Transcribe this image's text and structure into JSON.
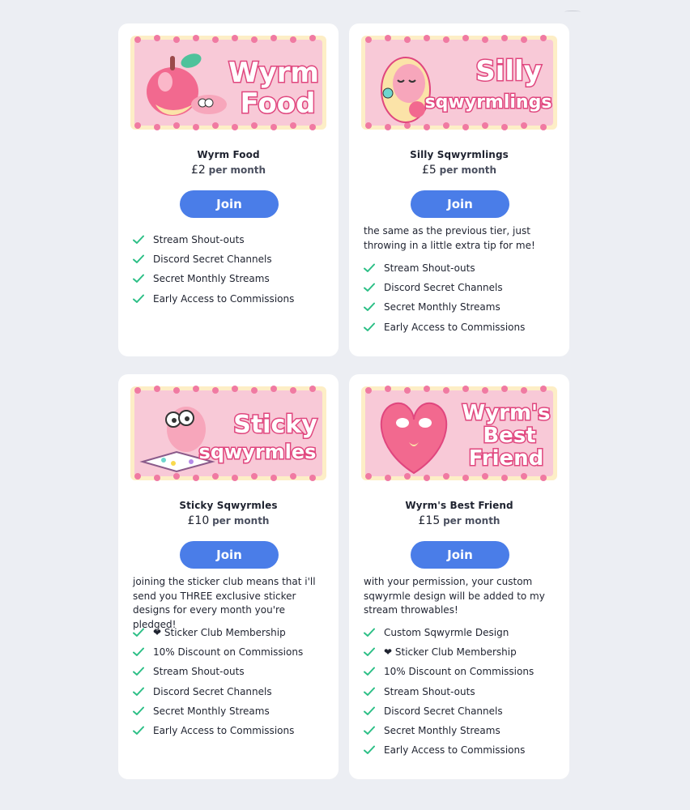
{
  "accent_color": "#4a7de8",
  "check_color": "#2cbf86",
  "currency": "£",
  "per_label": "per month",
  "join_label": "Join",
  "tiers": [
    {
      "name": "Wyrm Food",
      "banner_lines": [
        "Wyrm",
        "Food"
      ],
      "amount": "2",
      "description": "",
      "perks": [
        "Stream Shout-outs",
        "Discord Secret Channels",
        "Secret Monthly Streams",
        "Early Access to Commissions"
      ]
    },
    {
      "name": "Silly Sqwyrmlings",
      "banner_lines": [
        "Silly",
        "sqwyrmlings"
      ],
      "amount": "5",
      "description": "the same as the previous tier, just throwing in a little extra tip for me!",
      "perks": [
        "Stream Shout-outs",
        "Discord Secret Channels",
        "Secret Monthly Streams",
        "Early Access to Commissions"
      ]
    },
    {
      "name": "Sticky Sqwyrmles",
      "banner_lines": [
        "Sticky",
        "sqwyrmles"
      ],
      "amount": "10",
      "description": "joining the sticker club means that i'll send you THREE exclusive sticker designs for every month you're pledged!",
      "perks": [
        "❤ Sticker Club Membership",
        "10% Discount on Commissions",
        "Stream Shout-outs",
        "Discord Secret Channels",
        "Secret Monthly Streams",
        "Early Access to Commissions"
      ]
    },
    {
      "name": "Wyrm's Best Friend",
      "banner_lines": [
        "Wyrm's",
        "Best",
        "Friend"
      ],
      "amount": "15",
      "description": "with your permission, your custom sqwyrmle design will be added to my stream throwables!",
      "perks": [
        "Custom Sqwyrmle Design",
        "❤ Sticker Club Membership",
        "10% Discount on Commissions",
        "Stream Shout-outs",
        "Discord Secret Channels",
        "Secret Monthly Streams",
        "Early Access to Commissions"
      ]
    }
  ]
}
